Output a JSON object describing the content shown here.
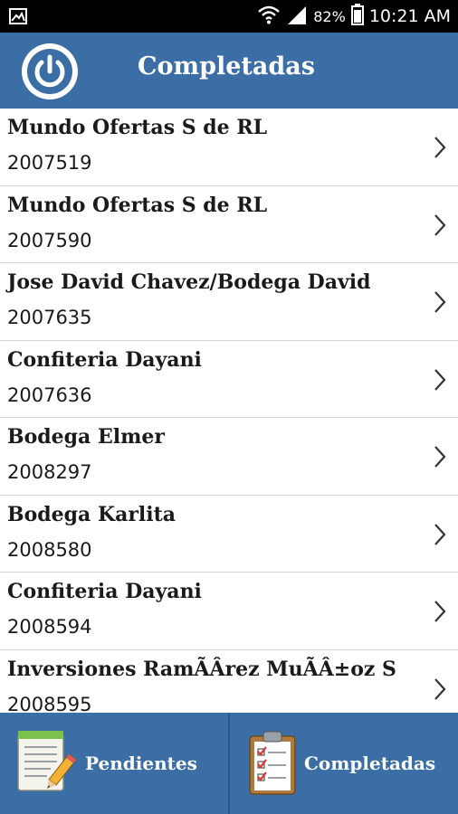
{
  "status_bar": {
    "battery": "82%",
    "time": "10:21 AM"
  },
  "header": {
    "title": "Completadas"
  },
  "orders": [
    {
      "name": "Mundo Ofertas S de RL",
      "code": "2007519"
    },
    {
      "name": "Mundo Ofertas S de RL",
      "code": "2007590"
    },
    {
      "name": "Jose  David Chavez/Bodega David",
      "code": "2007635"
    },
    {
      "name": "Confiteria Dayani",
      "code": "2007636"
    },
    {
      "name": "Bodega Elmer",
      "code": "2008297"
    },
    {
      "name": "Bodega Karlita",
      "code": "2008580"
    },
    {
      "name": "Confiteria Dayani",
      "code": "2008594"
    },
    {
      "name": "Inversiones RamÃÂrez MuÃÂ±oz S",
      "code": "2008595"
    }
  ],
  "tabs": {
    "pending_label": "Pendientes",
    "completed_label": "Completadas"
  },
  "colors": {
    "header_bg": "#3a6ea5",
    "status_bar_bg": "#000000",
    "divider": "#d4d4d4"
  }
}
